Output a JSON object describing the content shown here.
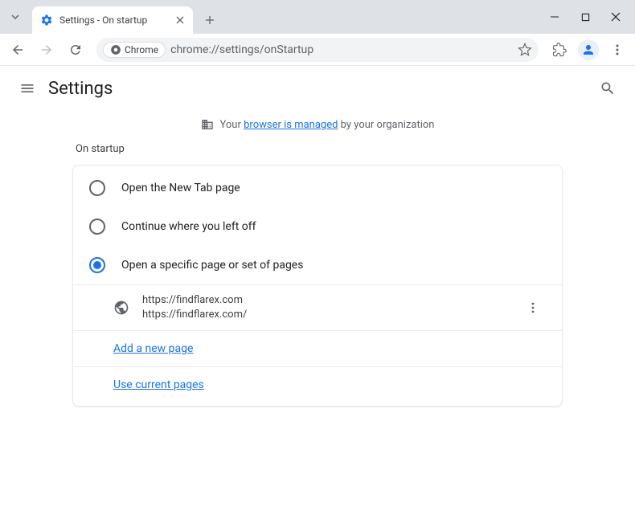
{
  "titlebar": {
    "tab_title": "Settings - On startup"
  },
  "toolbar": {
    "chip_label": "Chrome",
    "url": "chrome://settings/onStartup"
  },
  "header": {
    "title": "Settings"
  },
  "managed": {
    "prefix": "Your ",
    "link": "browser is managed",
    "suffix": " by your organization"
  },
  "section": {
    "title": "On startup",
    "options": [
      {
        "label": "Open the New Tab page",
        "checked": false
      },
      {
        "label": "Continue where you left off",
        "checked": false
      },
      {
        "label": "Open a specific page or set of pages",
        "checked": true
      }
    ],
    "pages": [
      {
        "title": "https://findflarex.com",
        "url": "https://findflarex.com/"
      }
    ],
    "add_page": "Add a new page",
    "use_current": "Use current pages"
  }
}
